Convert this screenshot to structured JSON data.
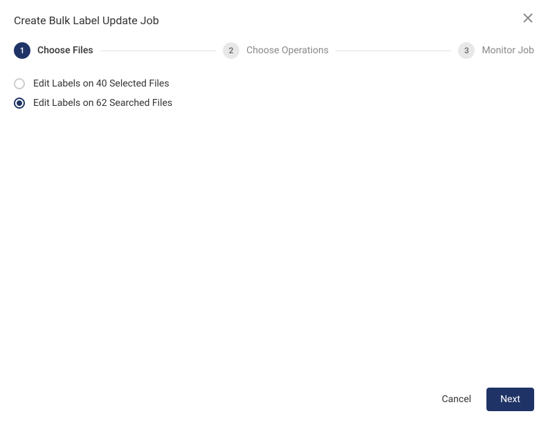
{
  "dialog": {
    "title": "Create Bulk Label Update Job"
  },
  "stepper": {
    "steps": [
      {
        "num": "1",
        "label": "Choose Files",
        "active": true
      },
      {
        "num": "2",
        "label": "Choose Operations",
        "active": false
      },
      {
        "num": "3",
        "label": "Monitor Job",
        "active": false
      }
    ]
  },
  "options": [
    {
      "label": "Edit Labels on 40 Selected Files",
      "selected": false
    },
    {
      "label": "Edit Labels on 62 Searched Files",
      "selected": true
    }
  ],
  "footer": {
    "cancel": "Cancel",
    "next": "Next"
  }
}
